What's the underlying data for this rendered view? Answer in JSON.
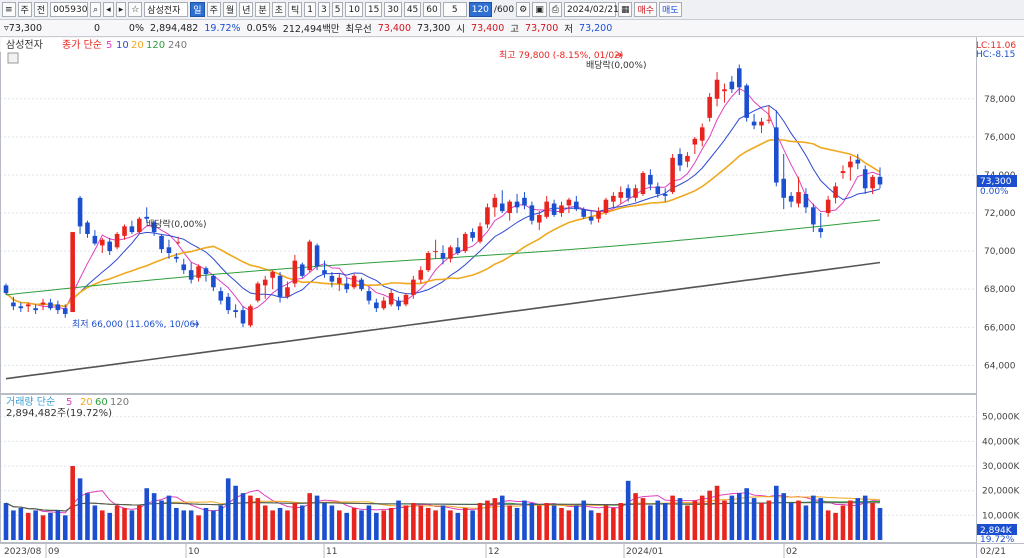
{
  "toolbar": {
    "period_select": "주",
    "search_label": "전",
    "code": "005930",
    "name": "삼성전자",
    "period_tabs": [
      "일",
      "주",
      "월",
      "년",
      "분",
      "초",
      "틱"
    ],
    "minute_tabs": [
      "1",
      "3",
      "5",
      "10",
      "15",
      "30",
      "45",
      "60",
      "5"
    ],
    "count": "120",
    "count_total": "/600",
    "date": "2024/02/21",
    "buy_label": "매수",
    "sell_label": "매도"
  },
  "info": {
    "price": "73,300",
    "change": "0",
    "change_pct": "0%",
    "volume": "2,894,482",
    "volume_ratio": "19.72%",
    "turnover": "0.05%",
    "amount": "212,494백만",
    "best_ask_label": "최우선",
    "best_ask": "73,400",
    "best_bid": "73,300",
    "open_label": "시",
    "open": "73,400",
    "high_label": "고",
    "high": "73,700",
    "low_label": "저",
    "low": "73,200"
  },
  "price_panel": {
    "stock_label": "삼성전자",
    "legend_prefix": "종가 단순",
    "ma_periods": [
      "5",
      "10",
      "20",
      "120",
      "240"
    ],
    "lc_label": "LC:11.06",
    "hc_label": "HC:-8.15",
    "current_price": "73,300",
    "current_pct": "0.00%",
    "high_annotation": "최고 79,800 (-8.15%, 01/02)",
    "low_annotation": "최저 66,000 (11.06%, 10/06)",
    "dividend_label_1": "배당락(0,00%)",
    "dividend_label_2": "배당락(0,00%)"
  },
  "volume_panel": {
    "legend_prefix": "거래량 단순",
    "ma_periods": [
      "5",
      "20",
      "60",
      "120"
    ],
    "value_text": "2,894,482주(19.72%)",
    "current": "2,894K",
    "current_pct": "19.72%"
  },
  "x_axis": {
    "labels": [
      "2023/08",
      "09",
      "10",
      "11",
      "12",
      "2024/01",
      "02",
      "02/21"
    ]
  },
  "colors": {
    "up": "#e8241f",
    "down": "#1b4fcf",
    "ma5": "#e040c0",
    "ma10": "#2f49d0",
    "ma20": "#f0a81c",
    "ma120": "#2e9d3c",
    "ma240": "#555555"
  },
  "chart_data": {
    "type": "candlestick",
    "y_axis": {
      "ticks": [
        64000,
        66000,
        68000,
        70000,
        72000,
        74000,
        76000,
        78000
      ],
      "ylim": [
        62600,
        80300
      ]
    },
    "volume_axis": {
      "ticks": [
        10000,
        20000,
        30000,
        40000,
        50000
      ],
      "unit": "K",
      "ylim": [
        0,
        58000
      ]
    },
    "ma_labels": [
      "5",
      "10",
      "20",
      "120",
      "240"
    ],
    "candles": [
      {
        "o": 68200,
        "h": 68300,
        "l": 67700,
        "c": 67800,
        "v": 15
      },
      {
        "o": 67300,
        "h": 67600,
        "l": 66900,
        "c": 67100,
        "v": 12
      },
      {
        "o": 67100,
        "h": 67300,
        "l": 66800,
        "c": 67000,
        "v": 13
      },
      {
        "o": 67100,
        "h": 67300,
        "l": 66800,
        "c": 67200,
        "v": 11
      },
      {
        "o": 67000,
        "h": 67200,
        "l": 66700,
        "c": 66900,
        "v": 12
      },
      {
        "o": 67200,
        "h": 67500,
        "l": 66900,
        "c": 67300,
        "v": 10
      },
      {
        "o": 67300,
        "h": 67500,
        "l": 66900,
        "c": 67000,
        "v": 11
      },
      {
        "o": 67200,
        "h": 67400,
        "l": 66700,
        "c": 66900,
        "v": 12
      },
      {
        "o": 67000,
        "h": 67200,
        "l": 66500,
        "c": 66700,
        "v": 10
      },
      {
        "o": 66800,
        "h": 71000,
        "l": 66800,
        "c": 71000,
        "v": 30
      },
      {
        "o": 72800,
        "h": 72900,
        "l": 70900,
        "c": 71300,
        "v": 25
      },
      {
        "o": 71500,
        "h": 71600,
        "l": 70700,
        "c": 70900,
        "v": 19
      },
      {
        "o": 70800,
        "h": 71100,
        "l": 70300,
        "c": 70400,
        "v": 14
      },
      {
        "o": 70300,
        "h": 70700,
        "l": 69900,
        "c": 70600,
        "v": 12
      },
      {
        "o": 70500,
        "h": 70700,
        "l": 69800,
        "c": 70000,
        "v": 11
      },
      {
        "o": 70200,
        "h": 71000,
        "l": 70100,
        "c": 70900,
        "v": 14
      },
      {
        "o": 70800,
        "h": 71400,
        "l": 70600,
        "c": 71300,
        "v": 13
      },
      {
        "o": 71300,
        "h": 71600,
        "l": 70900,
        "c": 71000,
        "v": 12
      },
      {
        "o": 71000,
        "h": 71800,
        "l": 70900,
        "c": 71700,
        "v": 14
      },
      {
        "o": 71800,
        "h": 72300,
        "l": 71500,
        "c": 71700,
        "v": 21
      },
      {
        "o": 71500,
        "h": 71600,
        "l": 70800,
        "c": 71000,
        "v": 19
      },
      {
        "o": 70800,
        "h": 70900,
        "l": 69900,
        "c": 70100,
        "v": 16
      },
      {
        "o": 70200,
        "h": 70600,
        "l": 69600,
        "c": 69900,
        "v": 18
      },
      {
        "o": 69700,
        "h": 69900,
        "l": 69400,
        "c": 69600,
        "v": 13
      },
      {
        "o": 69300,
        "h": 69600,
        "l": 68800,
        "c": 69000,
        "v": 12
      },
      {
        "o": 69000,
        "h": 69400,
        "l": 68300,
        "c": 68500,
        "v": 12
      },
      {
        "o": 68600,
        "h": 69300,
        "l": 68400,
        "c": 69200,
        "v": 10
      },
      {
        "o": 69100,
        "h": 69200,
        "l": 68400,
        "c": 68800,
        "v": 13
      },
      {
        "o": 68700,
        "h": 68800,
        "l": 67900,
        "c": 68100,
        "v": 12
      },
      {
        "o": 67900,
        "h": 68100,
        "l": 67200,
        "c": 67400,
        "v": 14
      },
      {
        "o": 67600,
        "h": 67800,
        "l": 66700,
        "c": 66900,
        "v": 25
      },
      {
        "o": 66900,
        "h": 67200,
        "l": 66500,
        "c": 66800,
        "v": 22
      },
      {
        "o": 66900,
        "h": 67100,
        "l": 66000,
        "c": 66200,
        "v": 19
      },
      {
        "o": 66100,
        "h": 67200,
        "l": 66000,
        "c": 67100,
        "v": 18
      },
      {
        "o": 67400,
        "h": 68400,
        "l": 67300,
        "c": 68300,
        "v": 17
      },
      {
        "o": 68200,
        "h": 68700,
        "l": 67500,
        "c": 68500,
        "v": 14
      },
      {
        "o": 68600,
        "h": 69000,
        "l": 68000,
        "c": 68900,
        "v": 12
      },
      {
        "o": 68700,
        "h": 68900,
        "l": 67300,
        "c": 67600,
        "v": 13
      },
      {
        "o": 67600,
        "h": 68400,
        "l": 67500,
        "c": 68100,
        "v": 12
      },
      {
        "o": 68300,
        "h": 69800,
        "l": 68100,
        "c": 69500,
        "v": 15
      },
      {
        "o": 69300,
        "h": 69400,
        "l": 68600,
        "c": 68700,
        "v": 14
      },
      {
        "o": 69000,
        "h": 70600,
        "l": 68900,
        "c": 70500,
        "v": 19
      },
      {
        "o": 70300,
        "h": 70400,
        "l": 69000,
        "c": 69200,
        "v": 18
      },
      {
        "o": 69000,
        "h": 69500,
        "l": 68600,
        "c": 68800,
        "v": 15
      },
      {
        "o": 68700,
        "h": 68900,
        "l": 68100,
        "c": 68400,
        "v": 14
      },
      {
        "o": 68300,
        "h": 68800,
        "l": 67900,
        "c": 68600,
        "v": 12
      },
      {
        "o": 68300,
        "h": 68600,
        "l": 67800,
        "c": 68000,
        "v": 11
      },
      {
        "o": 68100,
        "h": 68800,
        "l": 68000,
        "c": 68700,
        "v": 13
      },
      {
        "o": 68500,
        "h": 68600,
        "l": 67900,
        "c": 68000,
        "v": 12
      },
      {
        "o": 67900,
        "h": 68100,
        "l": 67200,
        "c": 67400,
        "v": 14
      },
      {
        "o": 67300,
        "h": 67500,
        "l": 66800,
        "c": 67000,
        "v": 11
      },
      {
        "o": 67000,
        "h": 67600,
        "l": 66900,
        "c": 67400,
        "v": 12
      },
      {
        "o": 67200,
        "h": 68000,
        "l": 67100,
        "c": 67800,
        "v": 13
      },
      {
        "o": 67400,
        "h": 67600,
        "l": 66900,
        "c": 67100,
        "v": 16
      },
      {
        "o": 67200,
        "h": 67800,
        "l": 67100,
        "c": 67700,
        "v": 14
      },
      {
        "o": 67700,
        "h": 68700,
        "l": 67500,
        "c": 68500,
        "v": 15
      },
      {
        "o": 68500,
        "h": 69200,
        "l": 68300,
        "c": 69000,
        "v": 14
      },
      {
        "o": 69000,
        "h": 70000,
        "l": 68900,
        "c": 69900,
        "v": 13
      },
      {
        "o": 70000,
        "h": 70600,
        "l": 69600,
        "c": 70000,
        "v": 12
      },
      {
        "o": 69900,
        "h": 70300,
        "l": 69300,
        "c": 69600,
        "v": 14
      },
      {
        "o": 69600,
        "h": 70300,
        "l": 69400,
        "c": 70200,
        "v": 12
      },
      {
        "o": 70200,
        "h": 70700,
        "l": 69800,
        "c": 69900,
        "v": 11
      },
      {
        "o": 70000,
        "h": 71000,
        "l": 69900,
        "c": 70900,
        "v": 13
      },
      {
        "o": 71000,
        "h": 71200,
        "l": 70500,
        "c": 70700,
        "v": 12
      },
      {
        "o": 70500,
        "h": 71500,
        "l": 70400,
        "c": 71300,
        "v": 15
      },
      {
        "o": 71400,
        "h": 72500,
        "l": 71200,
        "c": 72300,
        "v": 16
      },
      {
        "o": 72300,
        "h": 73000,
        "l": 71800,
        "c": 72800,
        "v": 17
      },
      {
        "o": 72500,
        "h": 73200,
        "l": 72000,
        "c": 72100,
        "v": 18
      },
      {
        "o": 72000,
        "h": 72700,
        "l": 71600,
        "c": 72600,
        "v": 14
      },
      {
        "o": 72600,
        "h": 73000,
        "l": 72000,
        "c": 72300,
        "v": 13
      },
      {
        "o": 72800,
        "h": 73100,
        "l": 72200,
        "c": 72400,
        "v": 16
      },
      {
        "o": 72400,
        "h": 72600,
        "l": 71400,
        "c": 71600,
        "v": 15
      },
      {
        "o": 71500,
        "h": 72100,
        "l": 71100,
        "c": 71900,
        "v": 14
      },
      {
        "o": 71800,
        "h": 72900,
        "l": 71700,
        "c": 72600,
        "v": 15
      },
      {
        "o": 72500,
        "h": 72700,
        "l": 71800,
        "c": 71900,
        "v": 14
      },
      {
        "o": 72000,
        "h": 72600,
        "l": 71800,
        "c": 72400,
        "v": 13
      },
      {
        "o": 72400,
        "h": 72800,
        "l": 72000,
        "c": 72700,
        "v": 12
      },
      {
        "o": 72600,
        "h": 72900,
        "l": 72100,
        "c": 72200,
        "v": 14
      },
      {
        "o": 72200,
        "h": 72300,
        "l": 71700,
        "c": 71800,
        "v": 16
      },
      {
        "o": 71800,
        "h": 72100,
        "l": 71400,
        "c": 71600,
        "v": 12
      },
      {
        "o": 71700,
        "h": 72300,
        "l": 71500,
        "c": 72100,
        "v": 11
      },
      {
        "o": 72000,
        "h": 72800,
        "l": 71900,
        "c": 72700,
        "v": 14
      },
      {
        "o": 72600,
        "h": 73100,
        "l": 72300,
        "c": 72900,
        "v": 13
      },
      {
        "o": 72800,
        "h": 73400,
        "l": 72500,
        "c": 73100,
        "v": 15
      },
      {
        "o": 73300,
        "h": 73500,
        "l": 72600,
        "c": 72800,
        "v": 24
      },
      {
        "o": 72800,
        "h": 73500,
        "l": 72600,
        "c": 73300,
        "v": 19
      },
      {
        "o": 73000,
        "h": 74200,
        "l": 72900,
        "c": 74100,
        "v": 17
      },
      {
        "o": 74000,
        "h": 74300,
        "l": 73200,
        "c": 73500,
        "v": 14
      },
      {
        "o": 73400,
        "h": 73600,
        "l": 72800,
        "c": 73000,
        "v": 16
      },
      {
        "o": 73000,
        "h": 73300,
        "l": 72600,
        "c": 72900,
        "v": 15
      },
      {
        "o": 73100,
        "h": 75100,
        "l": 73000,
        "c": 74900,
        "v": 18
      },
      {
        "o": 75100,
        "h": 75400,
        "l": 74200,
        "c": 74500,
        "v": 17
      },
      {
        "o": 74700,
        "h": 75200,
        "l": 74400,
        "c": 75000,
        "v": 14
      },
      {
        "o": 75600,
        "h": 76000,
        "l": 75100,
        "c": 75900,
        "v": 16
      },
      {
        "o": 75800,
        "h": 76700,
        "l": 75500,
        "c": 76500,
        "v": 18
      },
      {
        "o": 77000,
        "h": 78300,
        "l": 76800,
        "c": 78100,
        "v": 20
      },
      {
        "o": 78000,
        "h": 79400,
        "l": 77600,
        "c": 79000,
        "v": 22
      },
      {
        "o": 78400,
        "h": 78800,
        "l": 77800,
        "c": 78500,
        "v": 16
      },
      {
        "o": 78900,
        "h": 79200,
        "l": 78300,
        "c": 78500,
        "v": 18
      },
      {
        "o": 79600,
        "h": 79800,
        "l": 78200,
        "c": 78600,
        "v": 19
      },
      {
        "o": 78700,
        "h": 78800,
        "l": 76800,
        "c": 77000,
        "v": 21
      },
      {
        "o": 76800,
        "h": 77200,
        "l": 76400,
        "c": 76600,
        "v": 17
      },
      {
        "o": 76600,
        "h": 77000,
        "l": 76200,
        "c": 76800,
        "v": 15
      },
      {
        "o": 76900,
        "h": 77600,
        "l": 76700,
        "c": 76900,
        "v": 16
      },
      {
        "o": 76500,
        "h": 77400,
        "l": 73400,
        "c": 73600,
        "v": 22
      },
      {
        "o": 73800,
        "h": 75100,
        "l": 72200,
        "c": 72800,
        "v": 19
      },
      {
        "o": 72900,
        "h": 73100,
        "l": 72300,
        "c": 72600,
        "v": 15
      },
      {
        "o": 72500,
        "h": 73900,
        "l": 72300,
        "c": 73100,
        "v": 16
      },
      {
        "o": 73000,
        "h": 73300,
        "l": 72000,
        "c": 72300,
        "v": 14
      },
      {
        "o": 72300,
        "h": 72500,
        "l": 71000,
        "c": 71400,
        "v": 18
      },
      {
        "o": 71200,
        "h": 72000,
        "l": 70700,
        "c": 71000,
        "v": 17
      },
      {
        "o": 72000,
        "h": 72900,
        "l": 71800,
        "c": 72700,
        "v": 12
      },
      {
        "o": 72800,
        "h": 73600,
        "l": 72500,
        "c": 73400,
        "v": 11
      },
      {
        "o": 74100,
        "h": 74500,
        "l": 73800,
        "c": 74200,
        "v": 14
      },
      {
        "o": 74400,
        "h": 75000,
        "l": 73700,
        "c": 74700,
        "v": 16
      },
      {
        "o": 74800,
        "h": 75100,
        "l": 74300,
        "c": 74600,
        "v": 17
      },
      {
        "o": 74300,
        "h": 74500,
        "l": 73000,
        "c": 73300,
        "v": 18
      },
      {
        "o": 73300,
        "h": 74000,
        "l": 73000,
        "c": 73900,
        "v": 15
      },
      {
        "o": 73900,
        "h": 74400,
        "l": 73300,
        "c": 73500,
        "v": 13
      }
    ]
  }
}
